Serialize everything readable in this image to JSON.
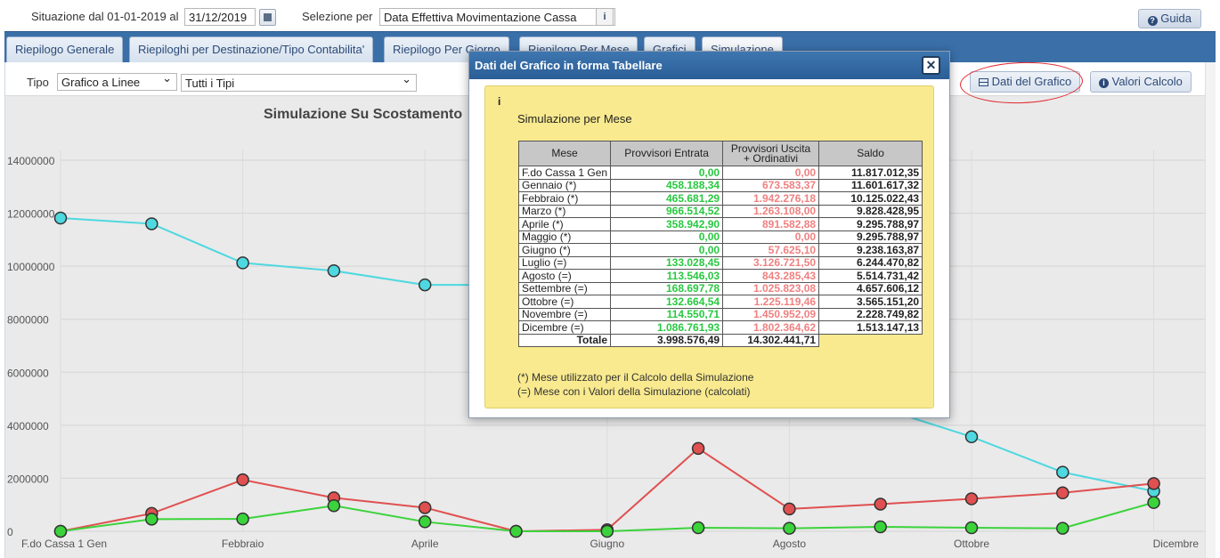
{
  "topbar": {
    "situazione_label": "Situazione dal 01-01-2019 al",
    "date_value": "31/12/2019",
    "selezione_label": "Selezione per",
    "selezione_value": "Data Effettiva Movimentazione Cassa",
    "guida_label": "Guida"
  },
  "tabs": [
    "Riepilogo Generale",
    "Riepiloghi per Destinazione/Tipo Contabilita'",
    "Riepilogo Per Giorno",
    "Riepilogo Per Mese",
    "Grafici",
    "Simulazione"
  ],
  "toolbar": {
    "tipo_label": "Tipo",
    "tipo_value": "Grafico a Linee",
    "tipi_value": "Tutti i Tipi",
    "dati_label": "Dati del Grafico",
    "valori_label": "Valori Calcolo"
  },
  "chart_data": {
    "type": "line",
    "title": "Simulazione Su Scostamento",
    "categories": [
      "F.do Cassa 1 Gen",
      "Gennaio",
      "Febbraio",
      "Marzo",
      "Aprile",
      "Maggio",
      "Giugno",
      "Luglio",
      "Agosto",
      "Settembre",
      "Ottobre",
      "Novembre",
      "Dicembre"
    ],
    "x_tick_labels": [
      "F.do Cassa 1 Gen",
      "Febbraio",
      "Aprile",
      "Giugno",
      "Agosto",
      "Ottobre",
      "Dicembre"
    ],
    "y_ticks": [
      0,
      2000000,
      4000000,
      6000000,
      8000000,
      10000000,
      12000000,
      14000000
    ],
    "ylim": [
      0,
      14000000
    ],
    "grid": true,
    "series": [
      {
        "color": "#4ed8e0",
        "values": [
          11817012.35,
          11601617.32,
          10125022.43,
          9828428.95,
          9295788.97,
          9295788.97,
          9238163.87,
          6244470.82,
          5514731.42,
          4657606.12,
          3565151.2,
          2228749.82,
          1513147.13
        ]
      },
      {
        "color": "#e05050",
        "values": [
          0,
          673583.37,
          1942276.18,
          1263108.0,
          891582.88,
          0,
          57625.1,
          3126721.5,
          843285.43,
          1025823.08,
          1225119.46,
          1450952.09,
          1802364.62
        ]
      },
      {
        "color": "#3bd33b",
        "values": [
          0,
          458188.34,
          465681.29,
          966514.52,
          358942.9,
          0,
          0,
          133028.45,
          113546.03,
          168697.78,
          132664.54,
          114550.71,
          1086761.93
        ]
      }
    ]
  },
  "modal": {
    "title": "Dati del Grafico in forma Tabellare",
    "close_label": "✕",
    "subtitle": "Simulazione per Mese",
    "headers": [
      "Mese",
      "Provvisori Entrata",
      "Provvisori Uscita + Ordinativi",
      "Saldo"
    ],
    "rows": [
      [
        "F.do Cassa 1 Gen",
        "0,00",
        "0,00",
        "11.817.012,35"
      ],
      [
        "Gennaio (*)",
        "458.188,34",
        "673.583,37",
        "11.601.617,32"
      ],
      [
        "Febbraio (*)",
        "465.681,29",
        "1.942.276,18",
        "10.125.022,43"
      ],
      [
        "Marzo (*)",
        "966.514,52",
        "1.263.108,00",
        "9.828.428,95"
      ],
      [
        "Aprile (*)",
        "358.942,90",
        "891.582,88",
        "9.295.788,97"
      ],
      [
        "Maggio (*)",
        "0,00",
        "0,00",
        "9.295.788,97"
      ],
      [
        "Giugno (*)",
        "0,00",
        "57.625,10",
        "9.238.163,87"
      ],
      [
        "Luglio (=)",
        "133.028,45",
        "3.126.721,50",
        "6.244.470,82"
      ],
      [
        "Agosto (=)",
        "113.546,03",
        "843.285,43",
        "5.514.731,42"
      ],
      [
        "Settembre (=)",
        "168.697,78",
        "1.025.823,08",
        "4.657.606,12"
      ],
      [
        "Ottobre (=)",
        "132.664,54",
        "1.225.119,46",
        "3.565.151,20"
      ],
      [
        "Novembre (=)",
        "114.550,71",
        "1.450.952,09",
        "2.228.749,82"
      ],
      [
        "Dicembre (=)",
        "1.086.761,93",
        "1.802.364,62",
        "1.513.147,13"
      ]
    ],
    "totale_label": "Totale",
    "totale_entrata": "3.998.576,49",
    "totale_uscita": "14.302.441,71",
    "note1": "(*) Mese utilizzato per il Calcolo della Simulazione",
    "note2": "(=) Mese con i Valori della Simulazione (calcolati)"
  },
  "colors": {
    "tab_strip": "#3a6fa8",
    "modal_header": "#2b5e96",
    "yellow_box": "#f9ea8f",
    "green_value": "#28c840",
    "red_value": "#f08080"
  }
}
